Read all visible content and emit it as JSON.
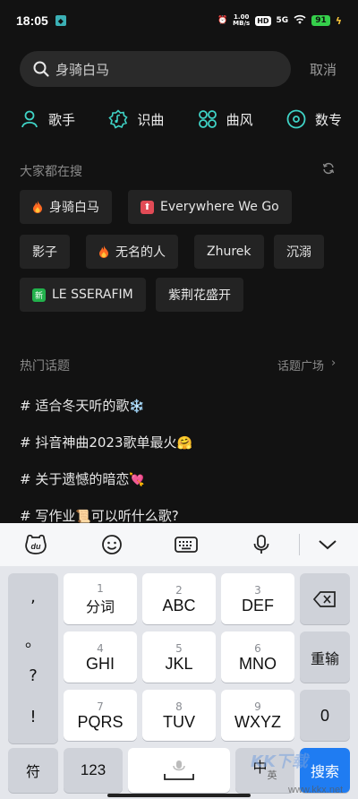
{
  "status_bar": {
    "time": "18:05",
    "net_speed": "1.00\nMB/s",
    "hd": "HD",
    "signal": "5G",
    "battery": "91"
  },
  "search": {
    "query": "身骑白马",
    "cancel": "取消"
  },
  "categories": [
    {
      "label": "歌手",
      "icon": "singer-icon"
    },
    {
      "label": "识曲",
      "icon": "recognize-icon"
    },
    {
      "label": "曲风",
      "icon": "genre-icon"
    },
    {
      "label": "数专",
      "icon": "album-icon"
    }
  ],
  "hot_search": {
    "title": "大家都在搜",
    "chips": [
      {
        "label": "身骑白马",
        "icon": "fire-icon"
      },
      {
        "label": "Everywhere We Go",
        "icon": "up-icon"
      },
      {
        "label": "影子",
        "icon": ""
      },
      {
        "label": "无名的人",
        "icon": "fire-icon"
      },
      {
        "label": "Zhurek",
        "icon": ""
      },
      {
        "label": "沉溺",
        "icon": ""
      },
      {
        "label": "LE SSERAFIM",
        "icon": "new-icon",
        "badge": "新"
      },
      {
        "label": "紫荆花盛开",
        "icon": ""
      }
    ]
  },
  "topics": {
    "title": "热门话题",
    "more": "话题广场",
    "items": [
      {
        "text": "# 适合冬天听的歌",
        "emoji": "❄️"
      },
      {
        "text": "# 抖音神曲2023歌单最火",
        "emoji": "🤗"
      },
      {
        "text": "# 关于遗憾的暗恋",
        "emoji": "💘"
      },
      {
        "text": "# 写作业",
        "emoji": "📜",
        "tail": "可以听什么歌?"
      }
    ]
  },
  "keyboard": {
    "punct": [
      ",",
      "。",
      "?",
      "!"
    ],
    "keys": [
      {
        "num": "1",
        "label": "分词"
      },
      {
        "num": "2",
        "label": "ABC"
      },
      {
        "num": "3",
        "label": "DEF"
      },
      {
        "num": "4",
        "label": "GHI"
      },
      {
        "num": "5",
        "label": "JKL"
      },
      {
        "num": "6",
        "label": "MNO"
      },
      {
        "num": "7",
        "label": "PQRS"
      },
      {
        "num": "8",
        "label": "TUV"
      },
      {
        "num": "9",
        "label": "WXYZ"
      }
    ],
    "backspace": "backspace-icon",
    "reenter": "重输",
    "zero": "0",
    "symbol": "符",
    "numeric": "123",
    "lang": "中",
    "lang_sub": "英",
    "search": "搜索"
  },
  "watermark": {
    "text": "KK下载",
    "url": "www.kkx.net"
  }
}
